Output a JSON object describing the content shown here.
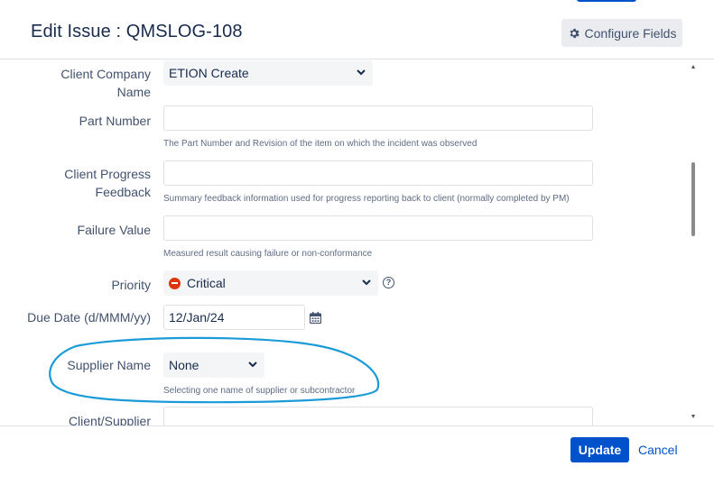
{
  "dialog": {
    "title": "Edit Issue : QMSLOG-108",
    "configure_fields_label": "Configure Fields"
  },
  "fields": {
    "client_company": {
      "label": "Client Company Name",
      "value": "ETION Create"
    },
    "part_number": {
      "label": "Part Number",
      "value": "",
      "description": "The Part Number and Revision of the item on which the incident was observed"
    },
    "client_progress": {
      "label": "Client Progress Feedback",
      "value": "",
      "description": "Summary feedback information used for progress reporting back to client (normally completed by PM)"
    },
    "failure_value": {
      "label": "Failure Value",
      "value": "",
      "description": "Measured result causing failure or non-conformance"
    },
    "priority": {
      "label": "Priority",
      "value": "Critical",
      "help": "?"
    },
    "due_date": {
      "label": "Due Date (d/MMM/yy)",
      "value": "12/Jan/24"
    },
    "supplier_name": {
      "label": "Supplier Name",
      "value": "None",
      "description": "Selecting one name of supplier or subcontractor"
    },
    "client_supplier": {
      "label": "Client/Supplier",
      "value": ""
    }
  },
  "footer": {
    "update_label": "Update",
    "cancel_label": "Cancel"
  },
  "colors": {
    "primary": "#0052cc",
    "critical": "#de350b",
    "annotation": "#1a9bd7"
  },
  "icons": [
    "gear-icon",
    "chevron-down-icon",
    "critical-priority-icon",
    "help-icon",
    "calendar-icon"
  ]
}
